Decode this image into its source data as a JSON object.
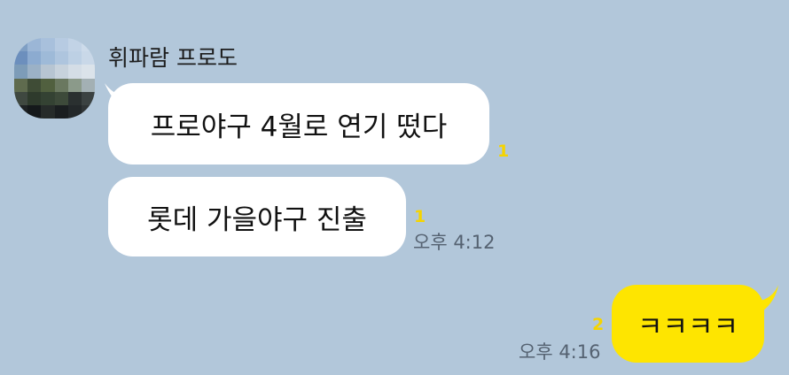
{
  "chat": {
    "sender_name": "휘파람 프로도",
    "messages": [
      {
        "text": "프로야구 4월로 연기 떴다",
        "unread": "1"
      },
      {
        "text": "롯데 가을야구 진출",
        "unread": "1",
        "time": "오후 4:12"
      }
    ],
    "reply": {
      "text": "ㅋㅋㅋㅋ",
      "unread": "2",
      "time": "오후 4:16"
    }
  },
  "colors": {
    "background": "#b2c7da",
    "incoming_bubble": "#ffffff",
    "outgoing_bubble": "#fee500",
    "unread_count": "#f5d400"
  },
  "icons": {
    "avatar": "pixelated-profile-avatar"
  }
}
